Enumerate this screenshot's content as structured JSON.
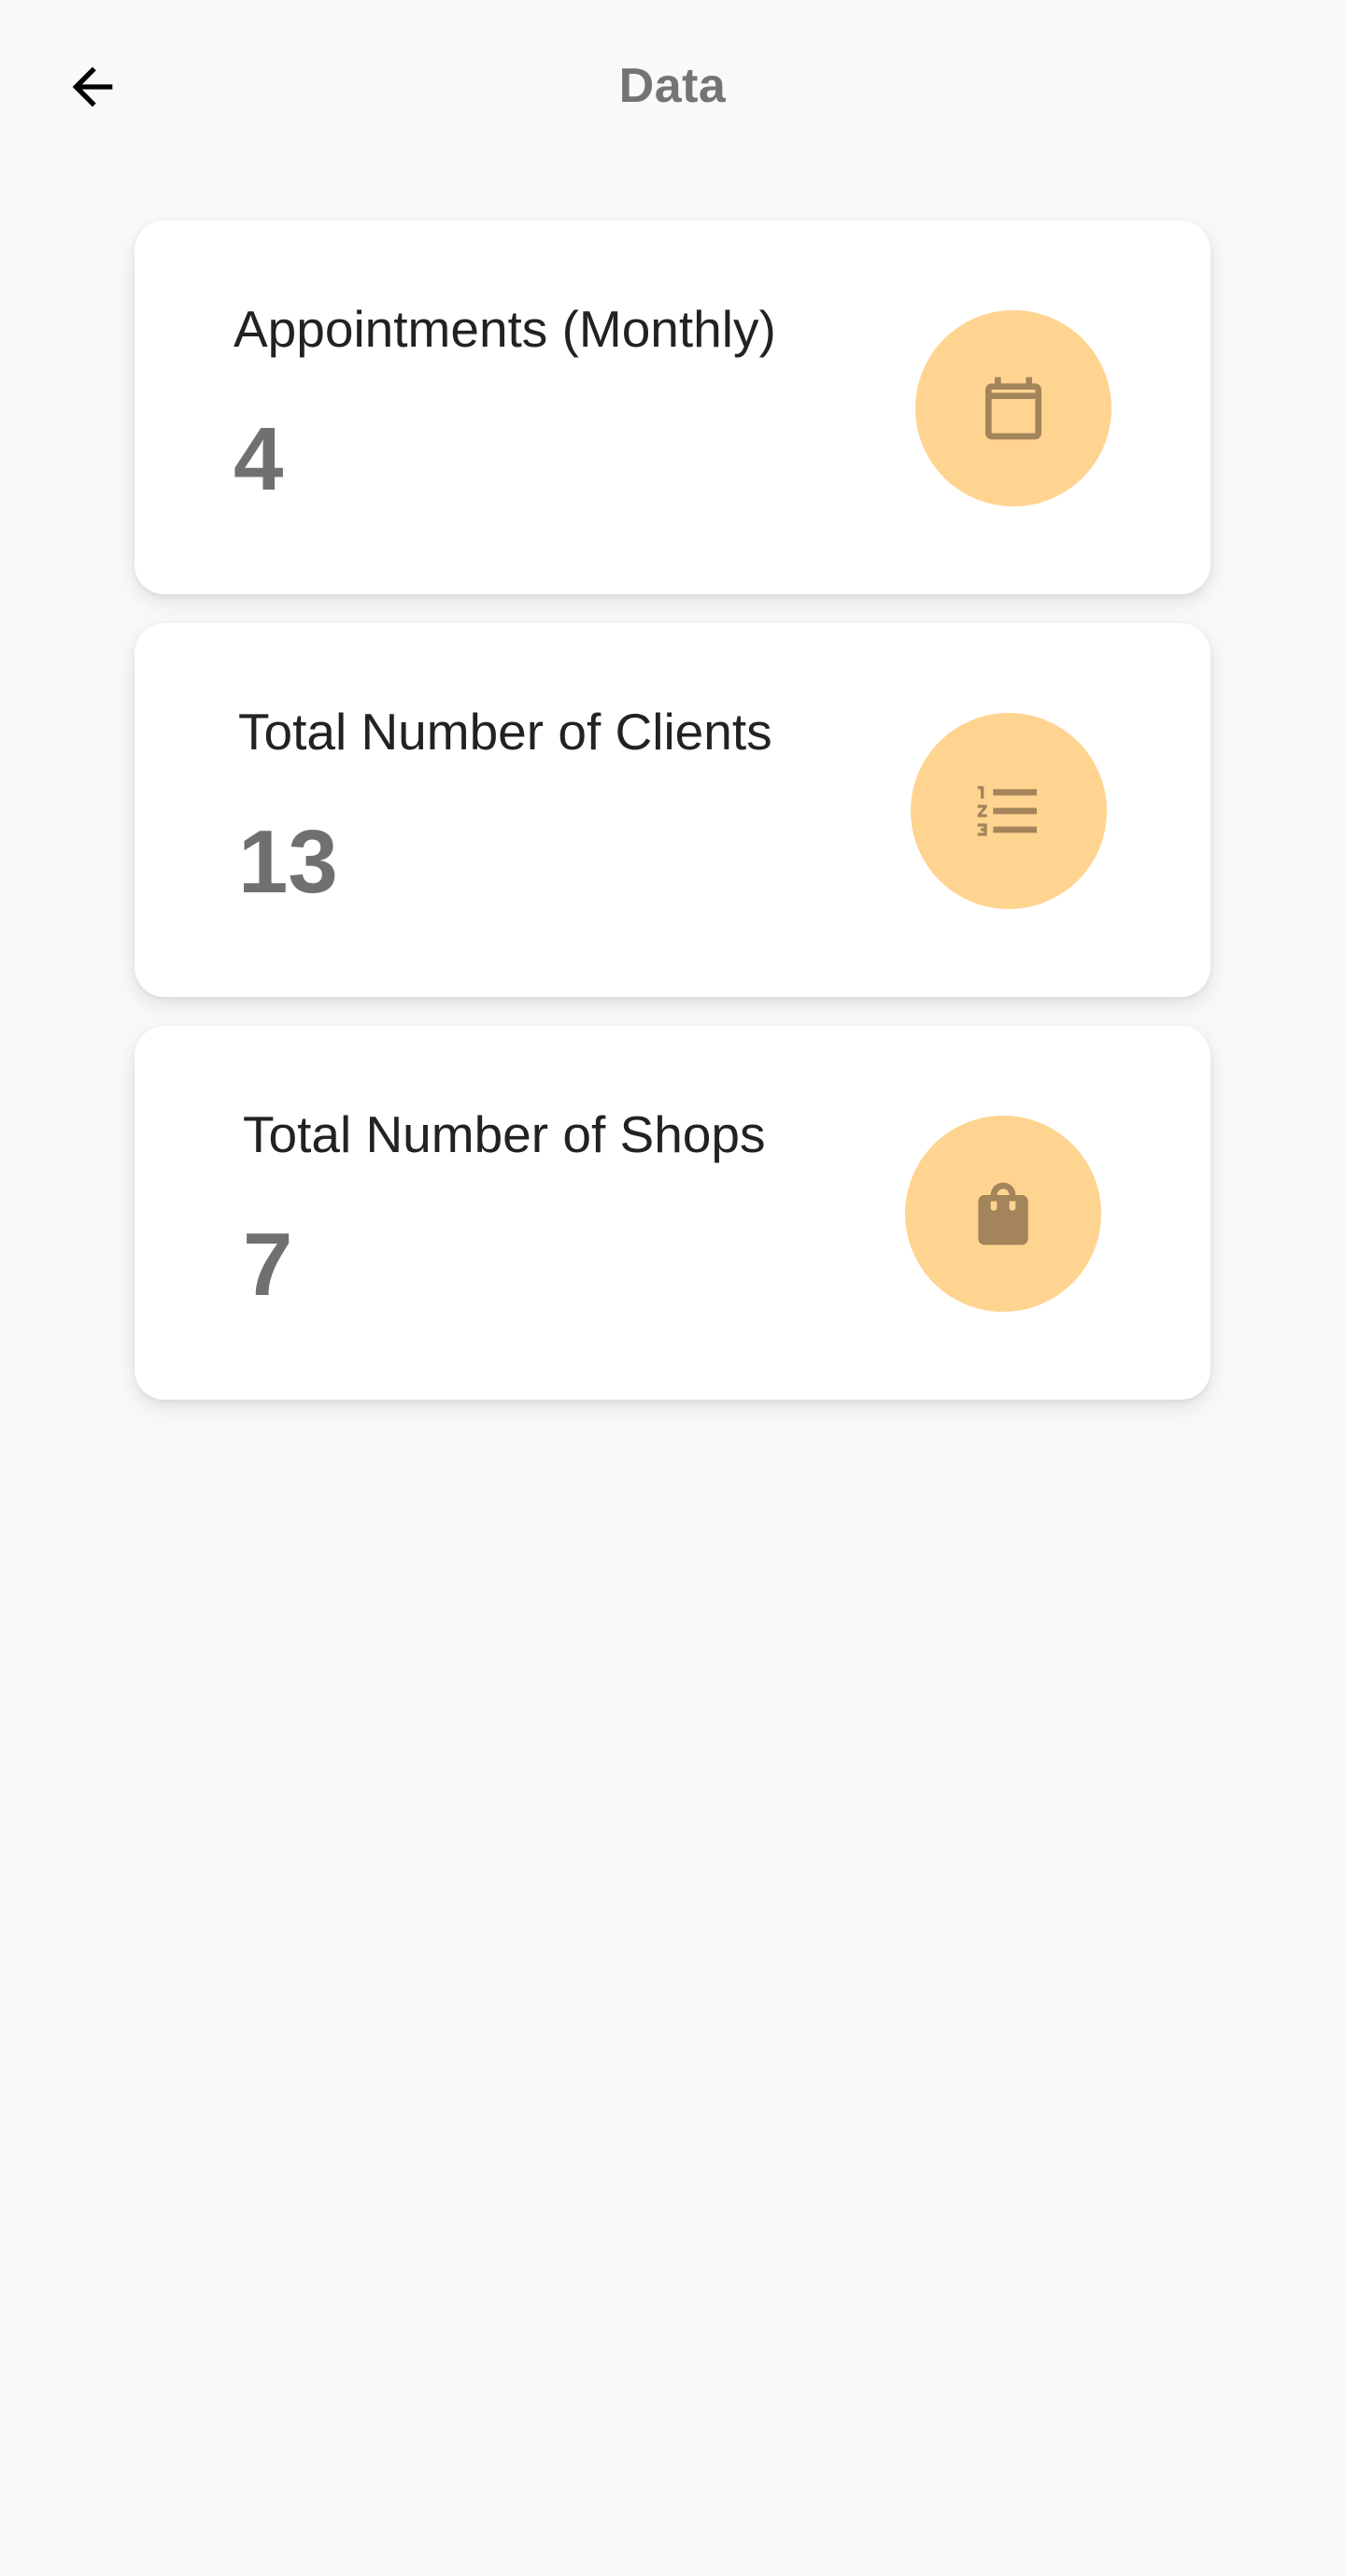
{
  "header": {
    "title": "Data",
    "back_icon": "arrow-back-icon"
  },
  "colors": {
    "background": "#f9f9f9",
    "card": "#ffffff",
    "icon_circle": "#ffd491",
    "icon_glyph": "#a3845b",
    "value_text": "#707070",
    "title_text": "#747474"
  },
  "cards": [
    {
      "label": "Appointments (Monthly)",
      "value": "4",
      "icon": "calendar-icon"
    },
    {
      "label": "Total Number of Clients",
      "value": "13",
      "icon": "numbered-list-icon"
    },
    {
      "label": "Total Number of Shops",
      "value": "7",
      "icon": "shopping-bag-icon"
    }
  ]
}
